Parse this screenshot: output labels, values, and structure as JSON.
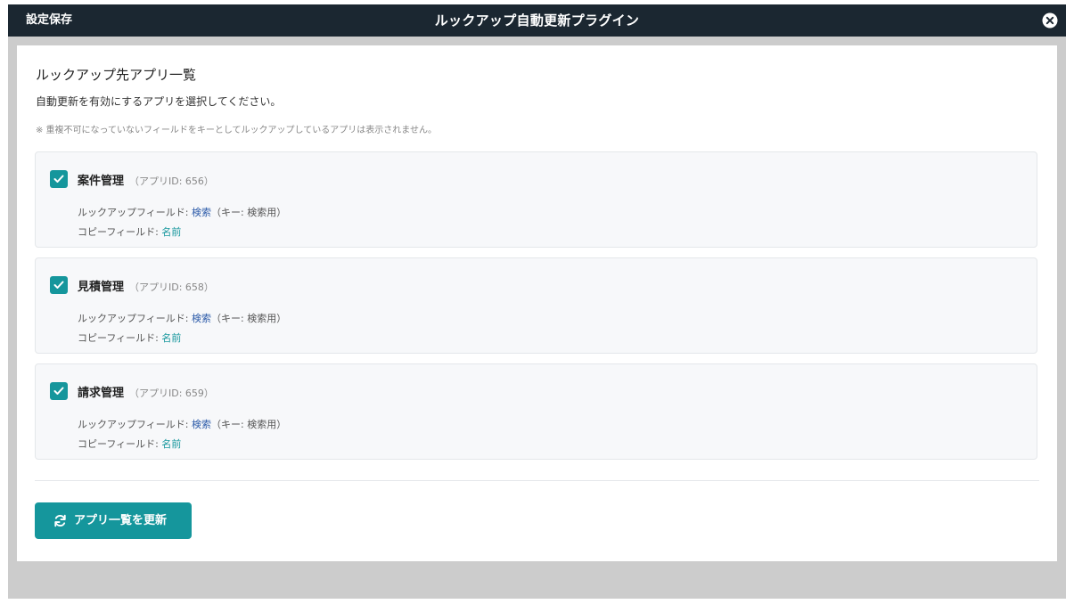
{
  "titlebar": {
    "save_label": "設定保存",
    "title": "ルックアップ自動更新プラグイン",
    "close_icon": "close-icon"
  },
  "main": {
    "heading": "ルックアップ先アプリ一覧",
    "description": "自動更新を有効にするアプリを選択してください。",
    "note": "※ 重複不可になっていないフィールドをキーとしてルックアップしているアプリは表示されません。",
    "apps": [
      {
        "name": "案件管理",
        "app_id": "（アプリID: 656）",
        "checked": true,
        "lookup_label": "ルックアップフィールド:",
        "lookup_field": "検索",
        "lookup_key": "（キー: 検索用）",
        "copy_label": "コピーフィールド:",
        "copy_field": "名前"
      },
      {
        "name": "見積管理",
        "app_id": "（アプリID: 658）",
        "checked": true,
        "lookup_label": "ルックアップフィールド:",
        "lookup_field": "検索",
        "lookup_key": "（キー: 検索用）",
        "copy_label": "コピーフィールド:",
        "copy_field": "名前"
      },
      {
        "name": "請求管理",
        "app_id": "（アプリID: 659）",
        "checked": true,
        "lookup_label": "ルックアップフィールド:",
        "lookup_field": "検索",
        "lookup_key": "（キー: 検索用）",
        "copy_label": "コピーフィールド:",
        "copy_field": "名前"
      }
    ],
    "refresh_button": {
      "label": "アプリ一覧を更新",
      "icon": "refresh-icon"
    }
  },
  "colors": {
    "titlebar_bg": "#1b2731",
    "accent": "#15969c",
    "link_blue": "#2b5aa8"
  }
}
